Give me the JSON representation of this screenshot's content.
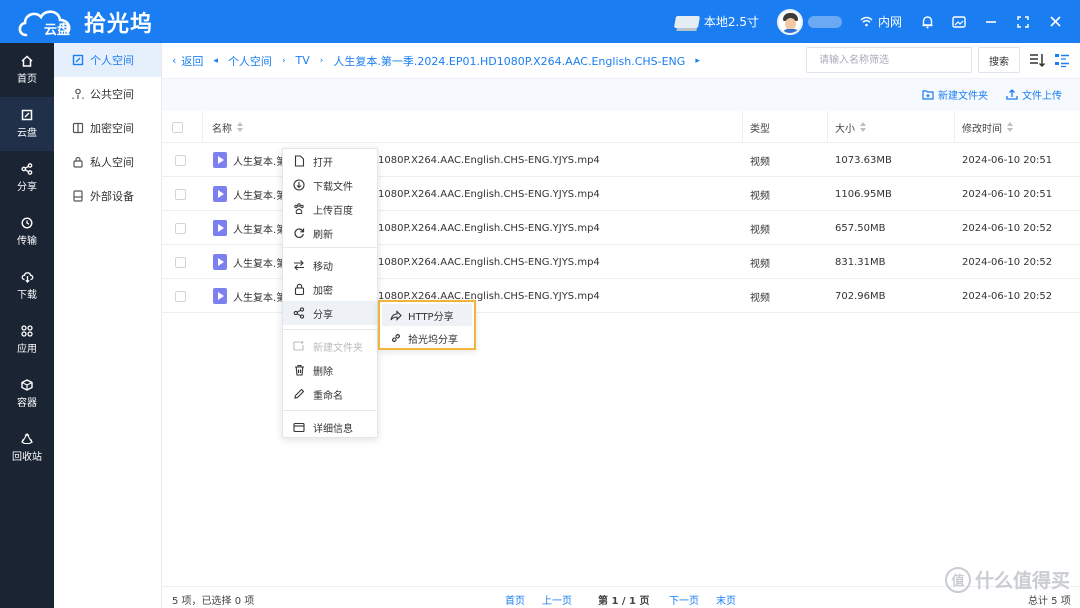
{
  "app": {
    "logo_text": "云盘",
    "title": "拾光坞"
  },
  "topbar": {
    "disk_label": "本地2.5寸",
    "network_label": "内网"
  },
  "nav": {
    "items": [
      {
        "label": "首页",
        "icon": "home-icon"
      },
      {
        "label": "云盘",
        "icon": "cloud-disk-icon"
      },
      {
        "label": "分享",
        "icon": "share-icon"
      },
      {
        "label": "传输",
        "icon": "transfer-icon"
      },
      {
        "label": "下载",
        "icon": "download-icon"
      },
      {
        "label": "应用",
        "icon": "apps-icon"
      },
      {
        "label": "容器",
        "icon": "container-icon"
      },
      {
        "label": "回收站",
        "icon": "recycle-icon"
      }
    ]
  },
  "sidebar": {
    "items": [
      {
        "label": "个人空间",
        "icon": "personal-space-icon"
      },
      {
        "label": "公共空间",
        "icon": "public-space-icon"
      },
      {
        "label": "加密空间",
        "icon": "encrypted-space-icon"
      },
      {
        "label": "私人空间",
        "icon": "private-space-icon"
      },
      {
        "label": "外部设备",
        "icon": "external-device-icon"
      }
    ]
  },
  "breadcrumb": {
    "back": "返回",
    "items": [
      "个人空间",
      "TV",
      "人生复本.第一季.2024.EP01.HD1080P.X264.AAC.English.CHS-ENG"
    ]
  },
  "search": {
    "placeholder": "请输入名称筛选",
    "button": "搜索"
  },
  "toolbar": {
    "new_folder": "新建文件夹",
    "upload": "文件上传"
  },
  "table": {
    "headers": {
      "name": "名称",
      "type": "类型",
      "size": "大小",
      "mtime": "修改时间"
    },
    "rows": [
      {
        "name_prefix": "人生复本.第",
        "name_suffix": "1080P.X264.AAC.English.CHS-ENG.YJYS.mp4",
        "type": "视频",
        "size": "1073.63MB",
        "mtime": "2024-06-10 20:51"
      },
      {
        "name_prefix": "人生复本.第",
        "name_suffix": "1080P.X264.AAC.English.CHS-ENG.YJYS.mp4",
        "type": "视频",
        "size": "1106.95MB",
        "mtime": "2024-06-10 20:51"
      },
      {
        "name_prefix": "人生复本.第",
        "name_suffix": "1080P.X264.AAC.English.CHS-ENG.YJYS.mp4",
        "type": "视频",
        "size": "657.50MB",
        "mtime": "2024-06-10 20:52"
      },
      {
        "name_prefix": "人生复本.第",
        "name_suffix": "1080P.X264.AAC.English.CHS-ENG.YJYS.mp4",
        "type": "视频",
        "size": "831.31MB",
        "mtime": "2024-06-10 20:52"
      },
      {
        "name_prefix": "人生复本.第",
        "name_suffix": "1080P.X264.AAC.English.CHS-ENG.YJYS.mp4",
        "type": "视频",
        "size": "702.96MB",
        "mtime": "2024-06-10 20:52"
      }
    ]
  },
  "context_menu": {
    "open": "打开",
    "download": "下载文件",
    "upload_baidu": "上传百度",
    "refresh": "刷新",
    "move": "移动",
    "encrypt": "加密",
    "share": "分享",
    "new_folder": "新建文件夹",
    "delete": "删除",
    "rename": "重命名",
    "details": "详细信息"
  },
  "share_submenu": {
    "http": "HTTP分享",
    "sgw": "拾光坞分享"
  },
  "footer": {
    "selection": "5 项，已选择 0 项",
    "first": "首页",
    "prev": "上一页",
    "page": "第 1 / 1 页",
    "next": "下一页",
    "last": "末页",
    "total": "总计 5 项"
  },
  "watermark": {
    "badge": "值",
    "text": "什么值得买"
  },
  "colors": {
    "accent": "#1a7ef2",
    "nav_bg": "#1a2433",
    "highlight_border": "#f0b43a"
  }
}
